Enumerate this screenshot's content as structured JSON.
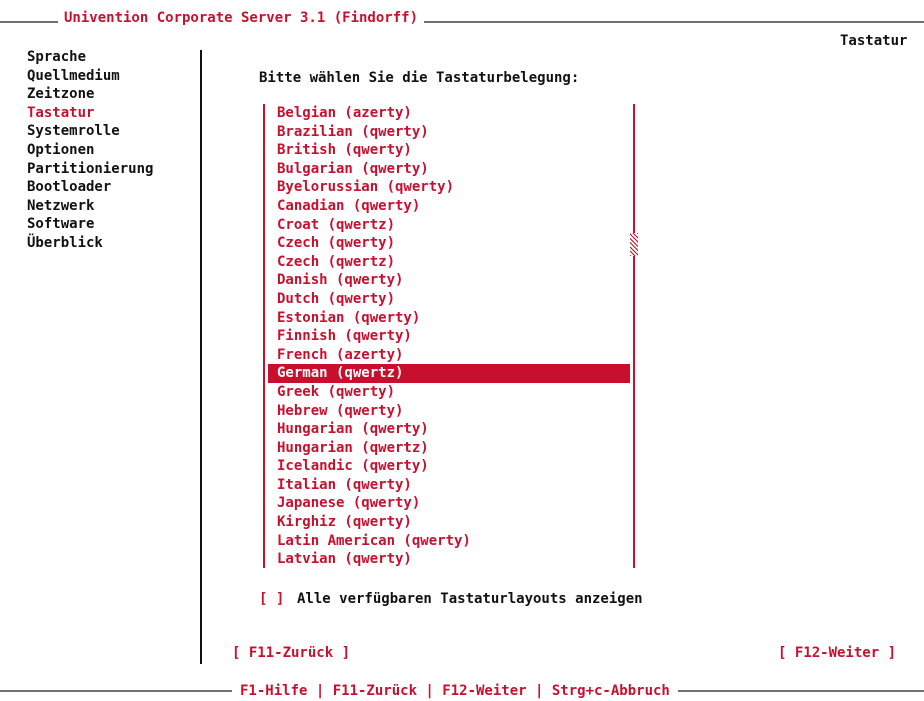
{
  "window": {
    "title": "Univention Corporate Server 3.1 (Findorff)"
  },
  "header": {
    "section_label": "Tastatur"
  },
  "sidebar": {
    "items": [
      {
        "label": "Sprache",
        "active": false
      },
      {
        "label": "Quellmedium",
        "active": false
      },
      {
        "label": "Zeitzone",
        "active": false
      },
      {
        "label": "Tastatur",
        "active": true
      },
      {
        "label": "Systemrolle",
        "active": false
      },
      {
        "label": "Optionen",
        "active": false
      },
      {
        "label": "Partitionierung",
        "active": false
      },
      {
        "label": "Bootloader",
        "active": false
      },
      {
        "label": "Netzwerk",
        "active": false
      },
      {
        "label": "Software",
        "active": false
      },
      {
        "label": "Überblick",
        "active": false
      }
    ]
  },
  "main": {
    "prompt": "Bitte wählen Sie die Tastaturbelegung:",
    "keyboard_layouts": [
      "Belgian (azerty)",
      "Brazilian (qwerty)",
      "British (qwerty)",
      "Bulgarian (qwerty)",
      "Byelorussian (qwerty)",
      "Canadian (qwerty)",
      "Croat (qwertz)",
      "Czech (qwerty)",
      "Czech (qwertz)",
      "Danish (qwerty)",
      "Dutch (qwerty)",
      "Estonian (qwerty)",
      "Finnish (qwerty)",
      "French (azerty)",
      "German (qwertz)",
      "Greek (qwerty)",
      "Hebrew (qwerty)",
      "Hungarian (qwerty)",
      "Hungarian (qwertz)",
      "Icelandic (qwerty)",
      "Italian (qwerty)",
      "Japanese (qwerty)",
      "Kirghiz (qwerty)",
      "Latin American (qwerty)",
      "Latvian (qwerty)"
    ],
    "selected_layout": "German (qwertz)",
    "show_all_checkbox": {
      "box": "[ ]",
      "label": "Alle verfügbaren Tastaturlayouts anzeigen",
      "checked": false
    }
  },
  "buttons": {
    "back": "[ F11-Zurück ]",
    "next": "[ F12-Weiter ]"
  },
  "footer": {
    "hints": "F1-Hilfe | F11-Zurück | F12-Weiter | Strg+c-Abbruch"
  },
  "colors": {
    "accent": "#c8102e",
    "text": "#111111",
    "background": "#ffffff",
    "border": "#6f6f6f"
  }
}
